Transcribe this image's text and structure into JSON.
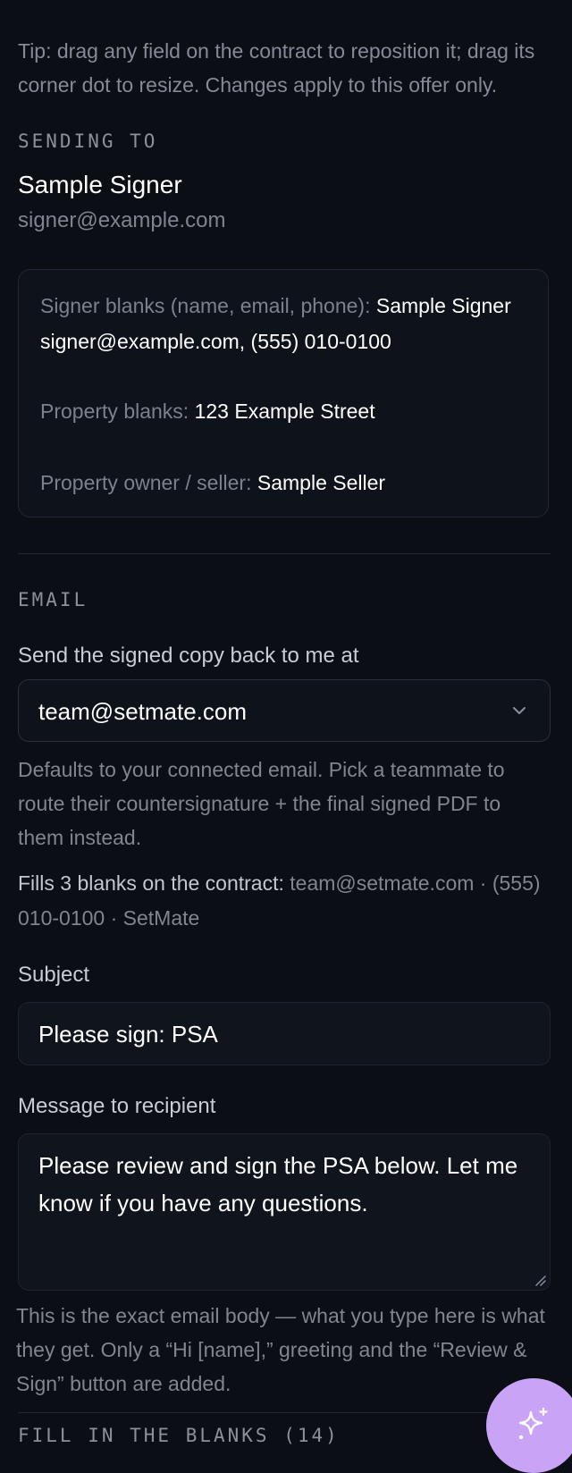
{
  "tip": "Tip: drag any field on the contract to reposition it; drag its corner dot to resize. Changes apply to this offer only.",
  "sending": {
    "label": "SENDING TO",
    "name": "Sample Signer",
    "email": "signer@example.com"
  },
  "blanks": {
    "signer_label": "Signer blanks (name, email, phone):",
    "signer_value": "Sample Signer signer@example.com, (555) 010-0100",
    "property_label": "Property blanks:",
    "property_value": "123 Example Street",
    "owner_label": "Property owner / seller:",
    "owner_value": "Sample Seller"
  },
  "email": {
    "label": "EMAIL",
    "send_back_label": "Send the signed copy back to me at",
    "selected": "team@setmate.com",
    "helper": "Defaults to your connected email. Pick a teammate to route their countersignature + the final signed PDF to them instead.",
    "fills_label": "Fills 3 blanks on the contract:",
    "fills_values": "team@setmate.com · (555) 010-0100 · SetMate",
    "subject_label": "Subject",
    "subject_value": "Please sign: PSA",
    "message_label": "Message to recipient",
    "message_value": "Please review and sign the PSA below. Let me know if you have any questions.",
    "body_helper": "This is the exact email body — what you type here is what they get. Only a “Hi [name],” greeting and the “Review & Sign” button are added."
  },
  "fill_blanks": {
    "label": "FILL IN THE BLANKS (14)"
  },
  "icons": {
    "chevron": "chevron-down-icon",
    "fab": "sparkles-icon",
    "fab_color": "#c9a3f6"
  }
}
